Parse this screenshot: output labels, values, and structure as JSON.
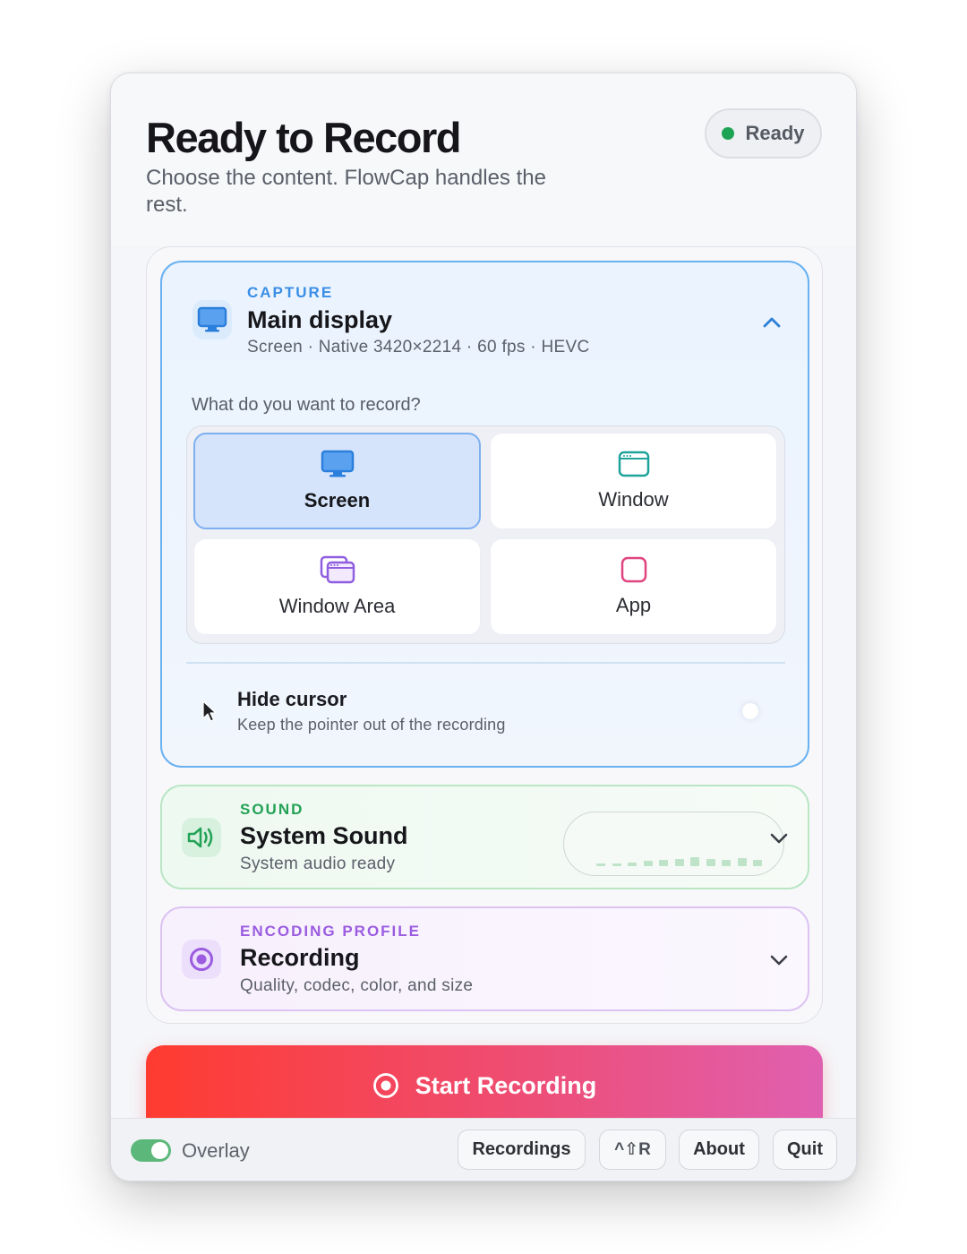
{
  "header": {
    "title": "Ready to Record",
    "subtitle": "Choose the content. FlowCap handles the rest.",
    "status": "Ready"
  },
  "capture": {
    "eyebrow": "CAPTURE",
    "title": "Main display",
    "subtitle": "Screen · Native 3420×2214 · 60 fps · HEVC",
    "question": "What do you want to record?",
    "options": [
      {
        "label": "Screen",
        "icon": "monitor-icon",
        "selected": true
      },
      {
        "label": "Window",
        "icon": "window-icon",
        "selected": false
      },
      {
        "label": "Window Area",
        "icon": "window-area-icon",
        "selected": false
      },
      {
        "label": "App",
        "icon": "app-icon",
        "selected": false
      }
    ],
    "hide_cursor": {
      "title": "Hide cursor",
      "subtitle": "Keep the pointer out of the recording",
      "enabled": false
    }
  },
  "sound": {
    "eyebrow": "SOUND",
    "title": "System Sound",
    "subtitle": "System audio ready",
    "meter_levels": [
      0.1,
      0.15,
      0.2,
      0.25,
      0.3,
      0.35,
      0.45,
      0.35,
      0.3,
      0.4,
      0.3
    ]
  },
  "encoding": {
    "eyebrow": "ENCODING PROFILE",
    "title": "Recording",
    "subtitle": "Quality, codec, color, and size"
  },
  "cta": {
    "label": "Start Recording"
  },
  "footer": {
    "overlay_label": "Overlay",
    "overlay_on": true,
    "recordings": "Recordings",
    "shortcut": "^⇧R",
    "about": "About",
    "quit": "Quit"
  },
  "colors": {
    "capture_accent": "#3a8ee6",
    "sound_accent": "#23a256",
    "encoding_accent": "#9b5ce0",
    "cta_start": "#ff3b30",
    "cta_end": "#e060b0",
    "status_green": "#1ea355"
  }
}
